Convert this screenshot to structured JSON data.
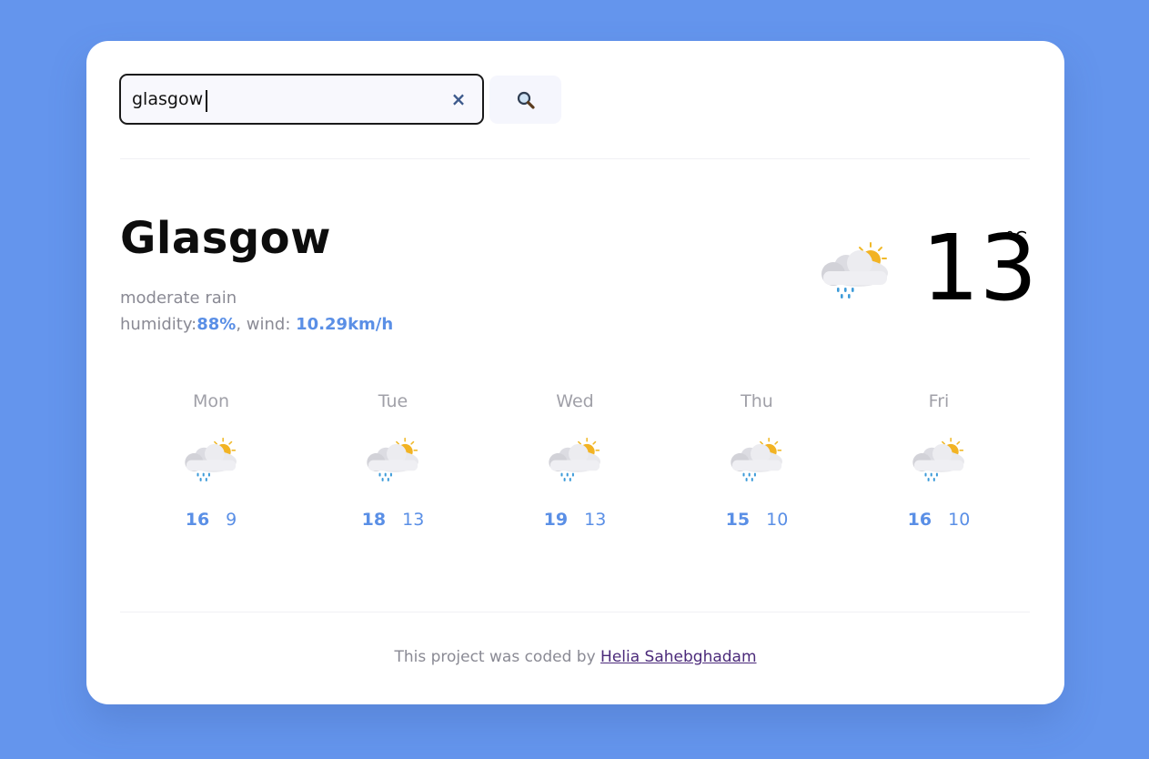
{
  "search": {
    "value": "glasgow",
    "clear_icon": "×"
  },
  "current": {
    "city": "Glasgow",
    "description": "moderate rain",
    "humidity_label": "humidity:",
    "humidity_value": "88%",
    "wind_label": ", wind: ",
    "wind_value": "10.29km/h",
    "temperature": "13",
    "unit": "°C",
    "icon": "sun-cloud-rain-icon"
  },
  "forecast": [
    {
      "day": "Mon",
      "max": "16",
      "min": "9",
      "icon": "sun-cloud-rain-icon"
    },
    {
      "day": "Tue",
      "max": "18",
      "min": "13",
      "icon": "sun-cloud-rain-icon"
    },
    {
      "day": "Wed",
      "max": "19",
      "min": "13",
      "icon": "sun-cloud-rain-icon"
    },
    {
      "day": "Thu",
      "max": "15",
      "min": "10",
      "icon": "sun-cloud-rain-icon"
    },
    {
      "day": "Fri",
      "max": "16",
      "min": "10",
      "icon": "sun-cloud-rain-icon"
    }
  ],
  "footer": {
    "text": "This project was coded by ",
    "link_text": "Helia Sahebghadam"
  },
  "colors": {
    "background": "#6495ed",
    "accent": "#5a8fe6",
    "link": "#4b2a7a"
  }
}
